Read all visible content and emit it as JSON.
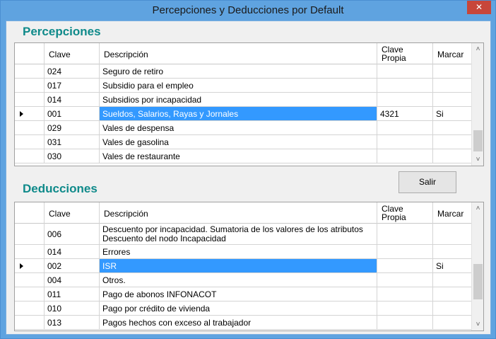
{
  "window": {
    "title": "Percepciones y Deducciones por Default",
    "close_label": "✕"
  },
  "percepciones": {
    "title": "Percepciones",
    "headers": {
      "clave": "Clave",
      "descripcion": "Descripción",
      "clave_propia": "Clave Propia",
      "marcar": "Marcar"
    },
    "rows": [
      {
        "clave": "024",
        "descripcion": "Seguro de retiro",
        "clave_propia": "",
        "marcar": ""
      },
      {
        "clave": "017",
        "descripcion": "Subsidio para el empleo",
        "clave_propia": "",
        "marcar": ""
      },
      {
        "clave": "014",
        "descripcion": "Subsidios por incapacidad",
        "clave_propia": "",
        "marcar": ""
      },
      {
        "clave": "001",
        "descripcion": "Sueldos, Salarios, Rayas y Jornales",
        "clave_propia": "4321",
        "marcar": "Si",
        "selected": true
      },
      {
        "clave": "029",
        "descripcion": "Vales de despensa",
        "clave_propia": "",
        "marcar": ""
      },
      {
        "clave": "031",
        "descripcion": "Vales de gasolina",
        "clave_propia": "",
        "marcar": ""
      },
      {
        "clave": "030",
        "descripcion": "Vales de restaurante",
        "clave_propia": "",
        "marcar": ""
      }
    ]
  },
  "deducciones": {
    "title": "Deducciones",
    "headers": {
      "clave": "Clave",
      "descripcion": "Descripción",
      "clave_propia": "Clave Propia",
      "marcar": "Marcar"
    },
    "rows": [
      {
        "clave": "006",
        "descripcion": "Descuento por incapacidad.  Sumatoria de los valores de los atributos Descuento del nodo Incapacidad",
        "clave_propia": "",
        "marcar": ""
      },
      {
        "clave": "014",
        "descripcion": "Errores",
        "clave_propia": "",
        "marcar": ""
      },
      {
        "clave": "002",
        "descripcion": "ISR",
        "clave_propia": "",
        "marcar": "Si",
        "selected": true
      },
      {
        "clave": "004",
        "descripcion": "Otros.",
        "clave_propia": "",
        "marcar": ""
      },
      {
        "clave": "011",
        "descripcion": "Pago de abonos INFONACOT",
        "clave_propia": "",
        "marcar": ""
      },
      {
        "clave": "010",
        "descripcion": "Pago por crédito de vivienda",
        "clave_propia": "",
        "marcar": ""
      },
      {
        "clave": "013",
        "descripcion": "Pagos hechos con exceso al trabajador",
        "clave_propia": "",
        "marcar": ""
      }
    ]
  },
  "buttons": {
    "salir": "Salir"
  }
}
